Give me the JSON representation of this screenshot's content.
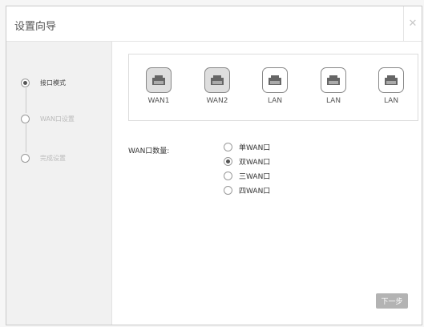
{
  "window": {
    "title": "设置向导",
    "close_icon": "close-icon"
  },
  "steps": [
    {
      "label": "接口模式",
      "active": true
    },
    {
      "label": "WAN口设置",
      "active": false
    },
    {
      "label": "完成设置",
      "active": false
    }
  ],
  "ports": [
    {
      "label": "WAN1",
      "icon": "ethernet-port-icon",
      "style": "wan"
    },
    {
      "label": "WAN2",
      "icon": "ethernet-port-icon",
      "style": "wan"
    },
    {
      "label": "LAN",
      "icon": "ethernet-port-icon",
      "style": "lan"
    },
    {
      "label": "LAN",
      "icon": "ethernet-port-icon",
      "style": "lan"
    },
    {
      "label": "LAN",
      "icon": "ethernet-port-icon",
      "style": "lan"
    }
  ],
  "wan_count": {
    "label": "WAN口数量:",
    "options": [
      {
        "label": "单WAN口",
        "checked": false
      },
      {
        "label": "双WAN口",
        "checked": true
      },
      {
        "label": "三WAN口",
        "checked": false
      },
      {
        "label": "四WAN口",
        "checked": false
      }
    ]
  },
  "next_button": {
    "label": "下一步"
  },
  "colors": {
    "port_wan": "#dedede",
    "port_lan": "#ffffff",
    "button": "#b3b3b3"
  }
}
